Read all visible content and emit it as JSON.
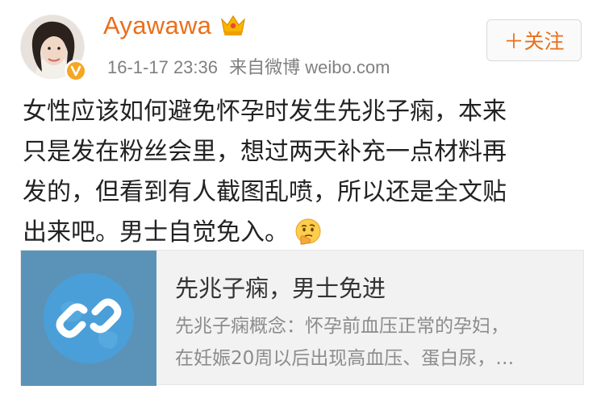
{
  "post": {
    "username": "Ayawawa",
    "timestamp": "16-1-17 23:36",
    "source": "来自微博 weibo.com",
    "follow_label": "＋关注",
    "content_lines": [
      "女性应该如何避免怀孕时发生先兆子痫，本来",
      "只是发在粉丝会里，想过两天补充一点材料再",
      "发的，但看到有人截图乱喷，所以还是全文贴",
      "出来吧。男士自觉免入。"
    ],
    "emoji": "thinking-face"
  },
  "card": {
    "title": "先兆子痫，男士免进",
    "desc_lines": [
      "先兆子痫概念：怀孕前血压正常的孕妇，",
      "在妊娠20周以后出现高血压、蛋白尿，…"
    ],
    "icon": "link-icon"
  },
  "colors": {
    "brand_orange": "#ea6f1a",
    "verified_badge": "#f6a623",
    "card_thumb": "#5b93b8",
    "muted_text": "#808080"
  }
}
